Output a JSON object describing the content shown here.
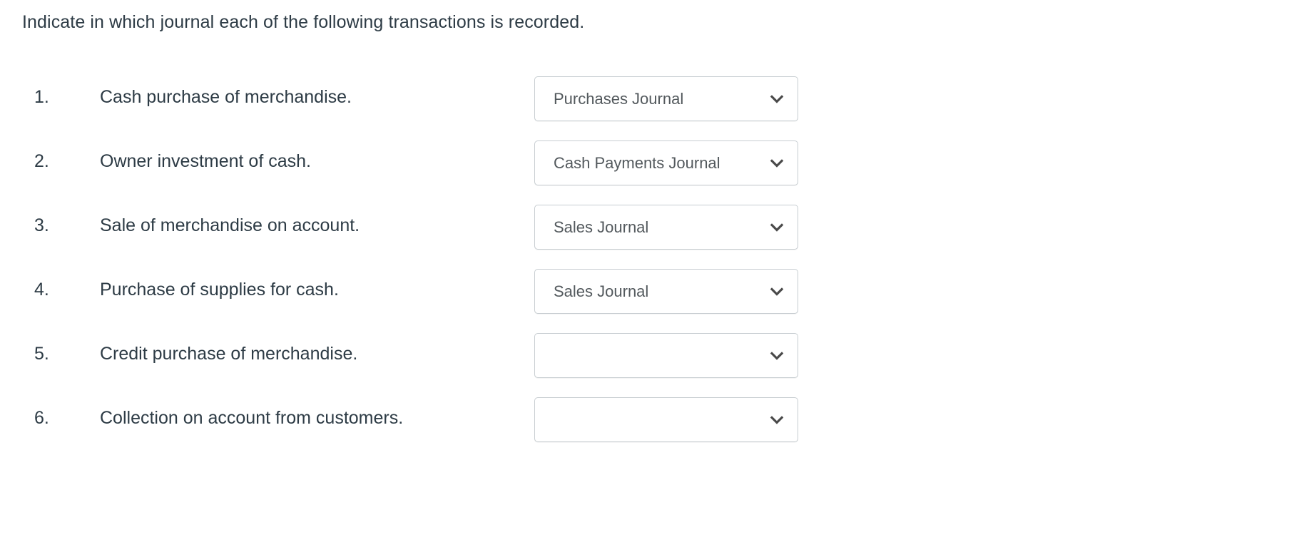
{
  "prompt": "Indicate in which journal each of the following transactions is recorded.",
  "icons": {
    "chevron_down": "chevron-down-icon"
  },
  "colors": {
    "text": "#2d3b45",
    "select_text": "#53595d",
    "select_border": "#c7cdd1",
    "background": "#ffffff"
  },
  "rows": [
    {
      "number": "1.",
      "label": "Cash purchase of merchandise.",
      "selected": "Purchases Journal"
    },
    {
      "number": "2.",
      "label": "Owner investment of cash.",
      "selected": "Cash Payments Journal"
    },
    {
      "number": "3.",
      "label": "Sale of merchandise on account.",
      "selected": "Sales Journal"
    },
    {
      "number": "4.",
      "label": "Purchase of supplies for cash.",
      "selected": "Sales Journal"
    },
    {
      "number": "5.",
      "label": "Credit purchase of merchandise.",
      "selected": ""
    },
    {
      "number": "6.",
      "label": "Collection on account from customers.",
      "selected": ""
    }
  ]
}
